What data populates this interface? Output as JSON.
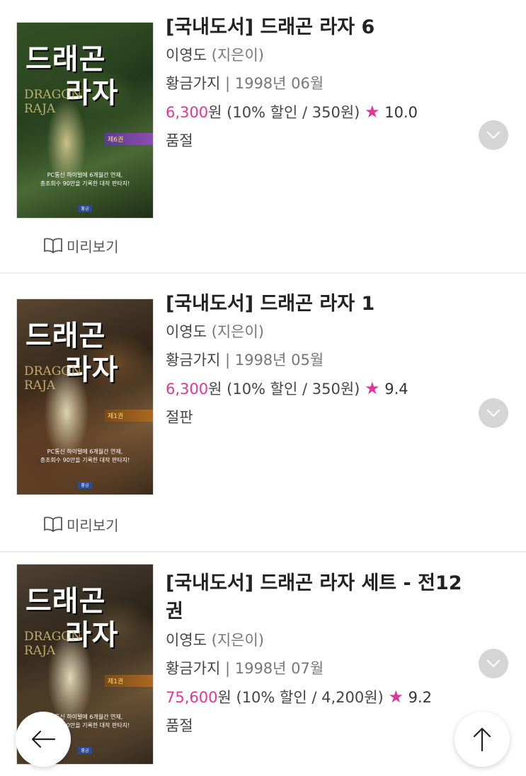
{
  "books": [
    {
      "title": "[국내도서] 드래곤 라자 6",
      "author": "이영도",
      "author_role": "(지은이)",
      "publisher": "황금가지",
      "date": "| 1998년 06월",
      "price": "6,300",
      "price_unit": "원",
      "discount": "(10% 할인 / 350원)",
      "rating": "10.0",
      "status": "품절",
      "preview_label": "미리보기",
      "cover": {
        "ko1": "드래곤",
        "ko2": "라자",
        "en": "DRAGON",
        "en2": "RAJA",
        "vol": "제6권",
        "tag1": "PC통신 하이텔에 6개월간 연재,",
        "tag2": "총조회수 90만을 기록한 대작 판타지!",
        "pub": "황금"
      }
    },
    {
      "title": "[국내도서] 드래곤 라자 1",
      "author": "이영도",
      "author_role": "(지은이)",
      "publisher": "황금가지",
      "date": "| 1998년 05월",
      "price": "6,300",
      "price_unit": "원",
      "discount": "(10% 할인 / 350원)",
      "rating": "9.4",
      "status": "절판",
      "preview_label": "미리보기",
      "cover": {
        "ko1": "드래곤",
        "ko2": "라자",
        "en": "DRAGON",
        "en2": "RAJA",
        "vol": "제1권",
        "tag1": "PC통신 하이텔에 6개월간 연재,",
        "tag2": "총조회수 90만을 기록한 대작 판타지!",
        "pub": "황금"
      }
    },
    {
      "title": "[국내도서] 드래곤 라자 세트 - 전12권",
      "author": "이영도",
      "author_role": "(지은이)",
      "publisher": "황금가지",
      "date": "| 1998년 07월",
      "price": "75,600",
      "price_unit": "원",
      "discount": "(10% 할인 / 4,200원)",
      "rating": "9.2",
      "status": "품절",
      "cover": {
        "ko1": "드래곤",
        "ko2": "라자",
        "en": "DRAGON",
        "en2": "RAJA",
        "vol": "제1권",
        "tag1": "PC통신 하이텔에 6개월간 연재,",
        "tag2": "총조회수 90만을 기록한 대작 판타지!",
        "pub": "황금"
      }
    }
  ],
  "icons": {
    "star": "star-icon",
    "chevron": "chevron-down-icon",
    "book": "book-open-icon",
    "back": "arrow-left-icon",
    "top": "arrow-up-icon"
  },
  "colors": {
    "accent": "#e0369a",
    "chevron_bg": "#d5d5d5",
    "divider": "#ececec"
  }
}
